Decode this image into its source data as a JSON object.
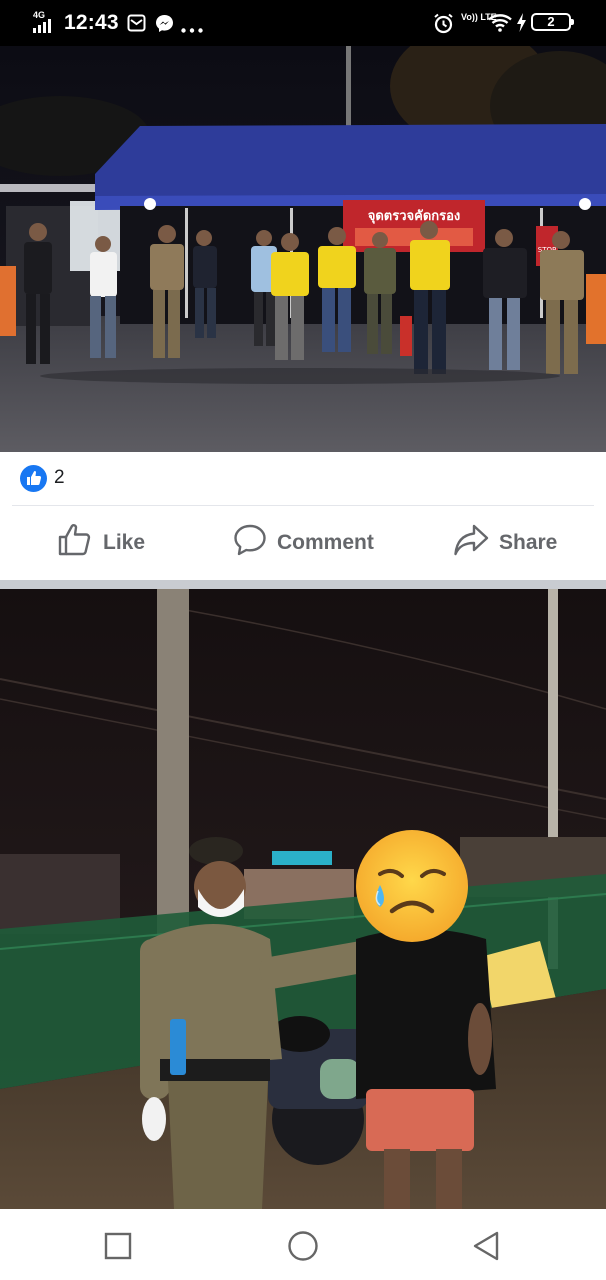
{
  "status_bar": {
    "network": "4G",
    "time": "12:43",
    "volte": "Vo)) LTE",
    "battery": "2"
  },
  "post": {
    "reaction_count": "2",
    "actions": {
      "like": "Like",
      "comment": "Comment",
      "share": "Share"
    },
    "photo1_banner_text": "จุดตรวจคัดกรอง",
    "photo1_sign_text": "STOP"
  },
  "icons": {
    "gmail": "gmail-icon",
    "messenger": "messenger-icon",
    "more": "more-dots-icon",
    "alarm": "alarm-icon",
    "wifi": "wifi-icon",
    "charging": "bolt-icon",
    "nav_recent": "square-icon",
    "nav_home": "circle-icon",
    "nav_back": "triangle-back-icon"
  },
  "colors": {
    "facebook_blue": "#1877f2",
    "action_gray": "#65676b",
    "tent_blue": "#2e3c9a",
    "banner_red": "#c0262c",
    "shirt_yellow": "#f0d31d"
  }
}
